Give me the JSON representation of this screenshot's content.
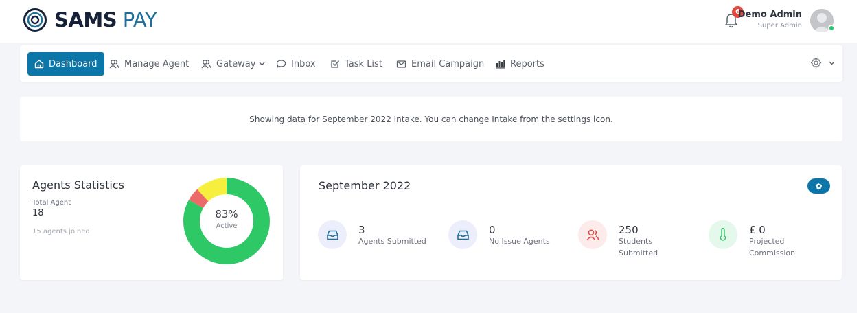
{
  "brand": {
    "name_bold": "SAMS",
    "name_light": "PAY",
    "primary_color": "#0d76a8"
  },
  "header": {
    "notification_count": "6",
    "user_name": "Demo Admin",
    "user_role": "Super Admin"
  },
  "nav": {
    "items": [
      {
        "label": "Dashboard",
        "icon": "home-icon",
        "active": true
      },
      {
        "label": "Manage Agent",
        "icon": "users-icon"
      },
      {
        "label": "Gateway",
        "icon": "users-icon",
        "dropdown": true
      },
      {
        "label": "Inbox",
        "icon": "chat-bubble-icon"
      },
      {
        "label": "Task List",
        "icon": "checkbox-icon"
      },
      {
        "label": "Email Campaign",
        "icon": "envelope-icon"
      },
      {
        "label": "Reports",
        "icon": "bar-chart-icon"
      }
    ]
  },
  "notice": {
    "text": "Showing data for September 2022 Intake. You can change Intake from the settings icon."
  },
  "agents_stats": {
    "title": "Agents Statistics",
    "total_label": "Total Agent",
    "total_value": "18",
    "joined_text": "15 agents joined",
    "donut_percent": "83%",
    "donut_label": "Active",
    "segments": [
      {
        "value": 83,
        "color": "#2ec866"
      },
      {
        "value": 5,
        "color": "#ec6a6a"
      },
      {
        "value": 12,
        "color": "#f7ef3d"
      }
    ]
  },
  "month_card": {
    "title": "September 2022",
    "stats": [
      {
        "value": "3",
        "label_lines": [
          "Agents Submitted"
        ],
        "icon": "inbox-tray-icon"
      },
      {
        "value": "0",
        "label_lines": [
          "No Issue Agents"
        ],
        "icon": "inbox-tray-icon"
      },
      {
        "value": "250",
        "label_lines": [
          "Students",
          "Submitted"
        ],
        "icon": "users-icon"
      },
      {
        "value": "£ 0",
        "label_lines": [
          "Projected",
          "Commission"
        ],
        "icon": "thermometer-icon"
      }
    ]
  }
}
